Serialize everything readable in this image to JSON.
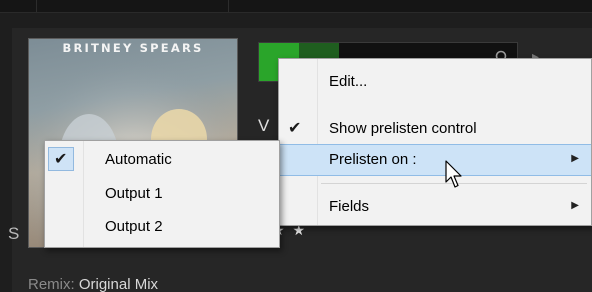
{
  "cover": {
    "artist": "BRITNEY SPEARS"
  },
  "track": {
    "title_peek": "V",
    "left_peek": "S",
    "rating_stars": "★ ★",
    "remix_key": "Remix:",
    "remix_value": "Original Mix"
  },
  "waveform": {
    "play_color": "#2aa52a",
    "search_icon": "search-icon"
  },
  "context_menu": {
    "items": [
      {
        "label": "Edit...",
        "checked": false,
        "submenu": false
      },
      {
        "label": "Show prelisten control",
        "checked": true,
        "submenu": false
      },
      {
        "label": "Prelisten on :",
        "checked": false,
        "submenu": true,
        "highlighted": true
      },
      {
        "label": "Fields",
        "checked": false,
        "submenu": true
      }
    ],
    "check_glyph": "✔",
    "submenu_arrow": "▶"
  },
  "prelisten_submenu": {
    "items": [
      {
        "label": "Automatic",
        "checked": true
      },
      {
        "label": "Output 1",
        "checked": false
      },
      {
        "label": "Output 2",
        "checked": false
      }
    ]
  },
  "colors": {
    "app_background": "#1e1e1e",
    "menu_background": "#f2f2f2",
    "menu_highlight": "#cde3f7",
    "accent_green": "#2aa52a"
  }
}
